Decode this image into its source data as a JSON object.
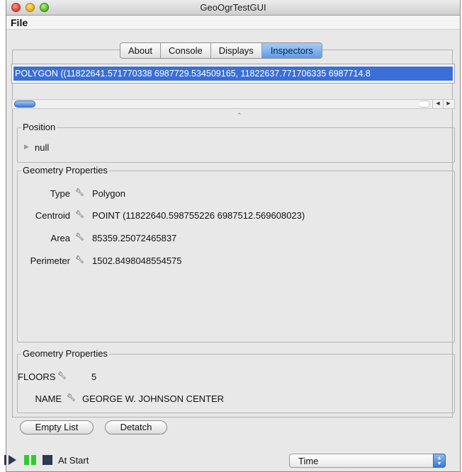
{
  "window": {
    "title": "GeoOgrTestGUI"
  },
  "menu": {
    "file": "File"
  },
  "tabs": [
    {
      "label": "About"
    },
    {
      "label": "Console"
    },
    {
      "label": "Displays"
    },
    {
      "label": "Inspectors"
    }
  ],
  "selected_tab": "Inspectors",
  "wkt_list": {
    "selected_item": "POLYGON ((11822641.571770338 6987729.534509165, 11822637.771706335 6987714.8"
  },
  "position": {
    "title": "Position",
    "value": "null"
  },
  "geometry_properties": {
    "title": "Geometry Properties",
    "rows": [
      {
        "label": "Type",
        "value": "Polygon"
      },
      {
        "label": "Centroid",
        "value": "POINT (11822640.598755226 6987512.569608023)"
      },
      {
        "label": "Area",
        "value": "85359.25072465837"
      },
      {
        "label": "Perimeter",
        "value": "1502.8498048554575"
      }
    ]
  },
  "attribute_properties": {
    "title": "Geometry Properties",
    "rows": [
      {
        "label": "FLOORS",
        "value": "5"
      },
      {
        "label": "NAME",
        "value": "GEORGE W. JOHNSON CENTER"
      }
    ]
  },
  "buttons": {
    "empty_list": "Empty List",
    "detatch": "Detatch"
  },
  "status": {
    "text": "At Start",
    "select_value": "Time"
  },
  "colors": {
    "selection": "#3a6fd8",
    "tab_active": "#5d9be8",
    "play_green": "#2ecc2e",
    "stop_navy": "#2b3a55"
  },
  "icons": {
    "wrench": "wrench-icon",
    "disclosure": "disclosure-triangle-icon",
    "play": "play-step-icon",
    "pause": "pause-icon",
    "stop": "stop-icon"
  }
}
